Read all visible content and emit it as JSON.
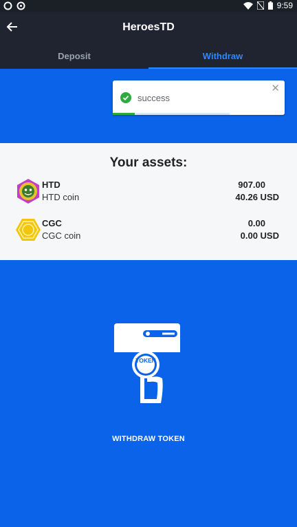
{
  "status_bar": {
    "time": "9:59",
    "icons": [
      "notification-icon",
      "notification-icon",
      "wifi-icon",
      "signal-off-icon",
      "battery-icon"
    ]
  },
  "app_bar": {
    "title": "HeroesTD",
    "back_icon": "back-arrow-icon"
  },
  "tabs": [
    {
      "label": "Deposit",
      "selected": false
    },
    {
      "label": "Withdraw",
      "selected": true
    }
  ],
  "toast": {
    "message": "success",
    "icon": "check-circle-icon",
    "close_icon": "close-icon"
  },
  "assets": {
    "heading": "Your assets:",
    "items": [
      {
        "symbol": "HTD",
        "name": "HTD coin",
        "amount": "907.00",
        "usd": "40.26 USD",
        "icon": "htd-coin-icon"
      },
      {
        "symbol": "CGC",
        "name": "CGC coin",
        "amount": "0.00",
        "usd": "0.00 USD",
        "icon": "cgc-coin-icon"
      }
    ]
  },
  "withdraw": {
    "token_label": "TOKEN",
    "button_label": "WITHDRAW TOKEN"
  },
  "colors": {
    "primary": "#0a63e8",
    "app_bar": "#1f2430",
    "tab_active": "#2f87ff",
    "success": "#2eaa3f"
  }
}
